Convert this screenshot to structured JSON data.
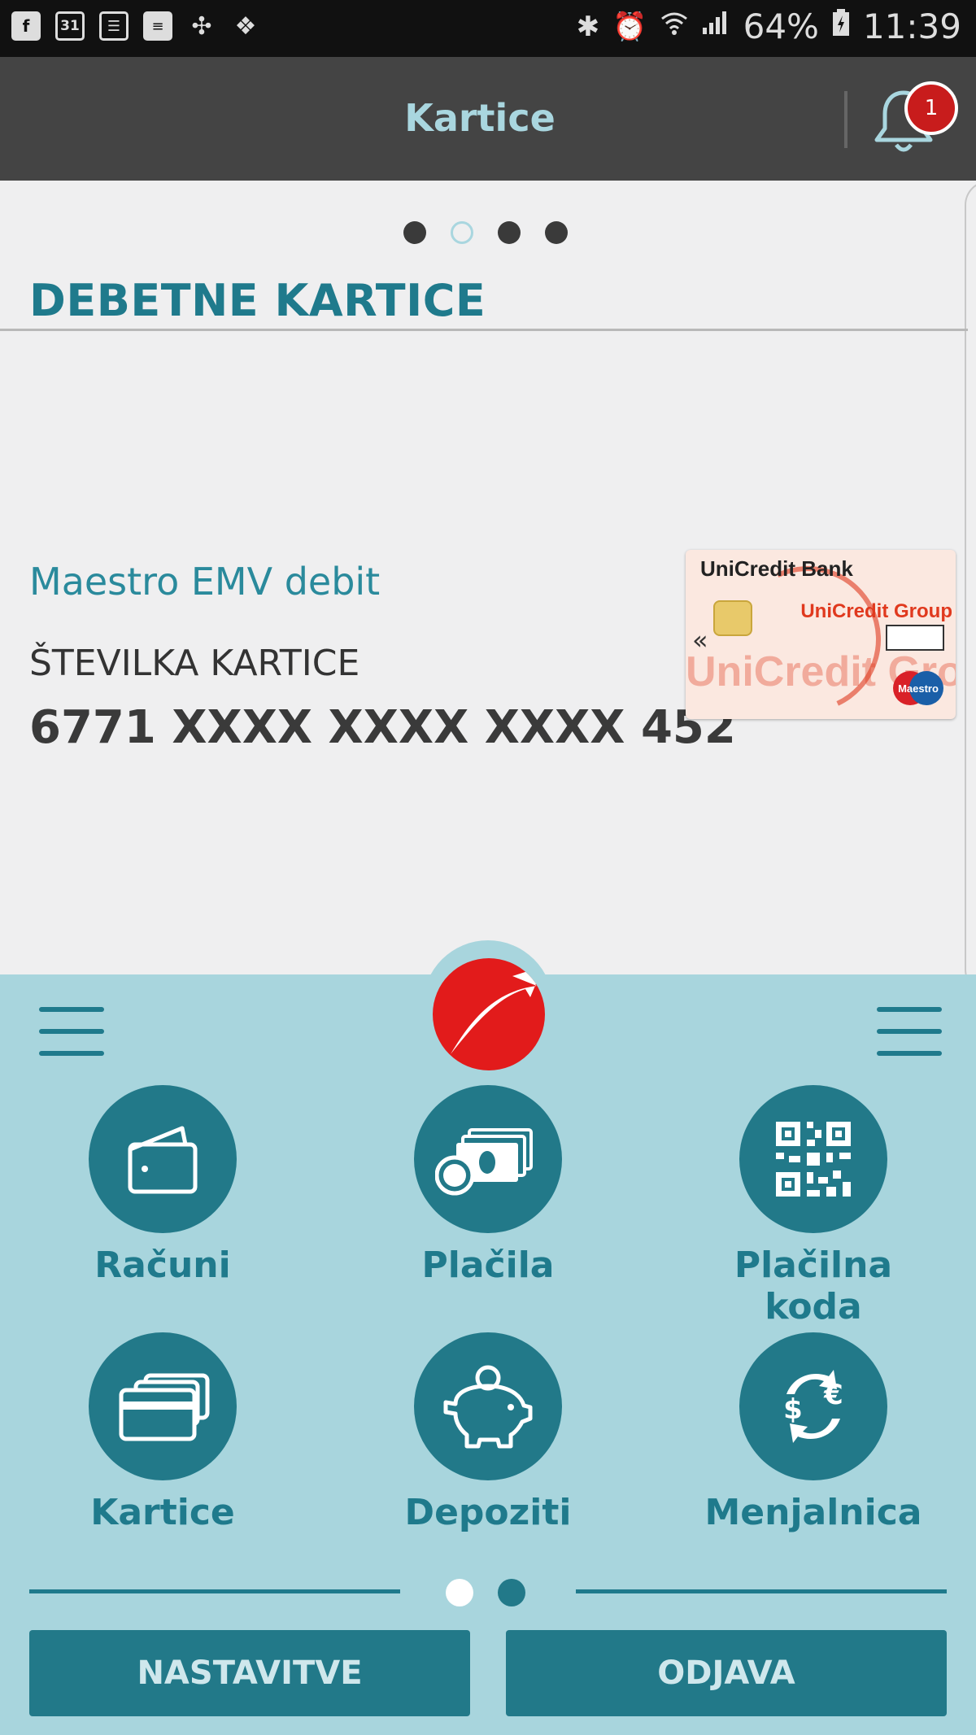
{
  "status_bar": {
    "left_icons": [
      "facebook-icon",
      "calendar-icon",
      "news-icon",
      "message-icon",
      "pinwheel-icon",
      "dropbox-icon"
    ],
    "calendar_day": "31",
    "battery": "64%",
    "time": "11:39"
  },
  "header": {
    "title": "Kartice",
    "notification_count": "1"
  },
  "pager_top": {
    "count": 4,
    "active_index": 1
  },
  "section": {
    "title": "DEBETNE KARTICE"
  },
  "card": {
    "type": "Maestro EMV debit",
    "number_label": "ŠTEVILKA KARTICE",
    "number": "6771 XXXX XXXX XXXX 452",
    "image_bank_text": "UniCredit Bank",
    "image_group_text": "UniCredit Group",
    "image_watermark_text": "UniCredit Group",
    "image_brand_text": "Maestro"
  },
  "menu": {
    "tiles": [
      {
        "label": "Računi",
        "icon": "wallet-icon"
      },
      {
        "label": "Plačila",
        "icon": "money-icon"
      },
      {
        "label": "Plačilna koda",
        "icon": "qr-code-icon"
      },
      {
        "label": "Kartice",
        "icon": "cards-icon"
      },
      {
        "label": "Depoziti",
        "icon": "piggy-bank-icon"
      },
      {
        "label": "Menjalnica",
        "icon": "exchange-icon"
      }
    ]
  },
  "pager_bottom": {
    "count": 2,
    "active_index": 0
  },
  "buttons": {
    "settings": "NASTAVITVE",
    "logout": "ODJAVA"
  },
  "colors": {
    "accent": "#1f7a8c",
    "panel": "#a8d5dd",
    "header_bg": "#444444",
    "brand_red": "#e21b1b"
  }
}
